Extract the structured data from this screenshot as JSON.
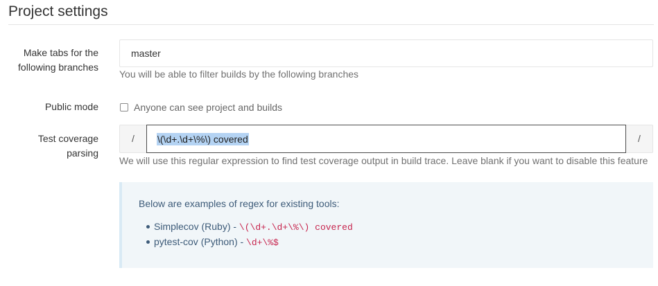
{
  "header": {
    "title": "Project settings"
  },
  "branches": {
    "label": "Make tabs for the following branches",
    "value": "master",
    "help": "You will be able to filter builds by the following branches"
  },
  "public_mode": {
    "label": "Public mode",
    "checkbox_label": "Anyone can see project and builds",
    "checked": false
  },
  "coverage": {
    "label": "Test coverage parsing",
    "prefix": "/",
    "suffix": "/",
    "value": "\\(\\d+.\\d+\\%\\) covered",
    "help": "We will use this regular expression to find test coverage output in build trace. Leave blank if you want to disable this feature"
  },
  "examples": {
    "title": "Below are examples of regex for existing tools:",
    "items": [
      {
        "tool": "Simplecov (Ruby) - ",
        "regex": "\\(\\d+.\\d+\\%\\) covered"
      },
      {
        "tool": "pytest-cov (Python) - ",
        "regex": "\\d+\\%$"
      }
    ]
  },
  "colors": {
    "code": "#c7254e",
    "info_text": "#3c5a78",
    "info_bg": "#f1f6f9",
    "selection": "#b4d3f3"
  }
}
